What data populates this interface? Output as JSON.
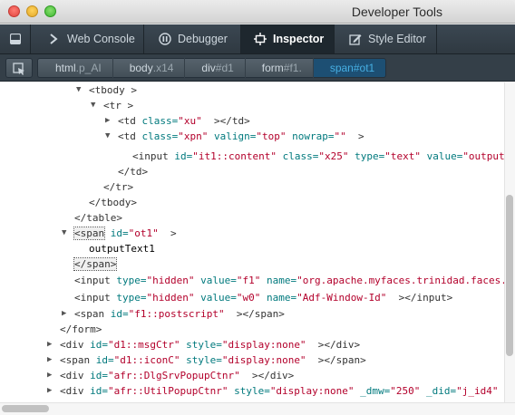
{
  "window": {
    "title": "Developer Tools"
  },
  "tabs": [
    {
      "label": "Web Console",
      "icon": "console-icon"
    },
    {
      "label": "Debugger",
      "icon": "pause-icon"
    },
    {
      "label": "Inspector",
      "icon": "inspector-icon",
      "active": true
    },
    {
      "label": "Style Editor",
      "icon": "style-editor-icon"
    }
  ],
  "breadcrumbs": [
    {
      "tag": "html",
      "attr": ".p_AI"
    },
    {
      "tag": "body",
      "attr": ".x14"
    },
    {
      "tag": "div",
      "attr": "#d1"
    },
    {
      "tag": "form",
      "attr": "#f1."
    },
    {
      "tag": "span",
      "attr": "#ot1",
      "selected": true
    }
  ],
  "markup": {
    "l1": {
      "tag": "<tbody",
      "close": " >"
    },
    "l2": {
      "tag": "<tr",
      "close": " >"
    },
    "l3": {
      "tag": "<td",
      "a1n": " class=",
      "a1v": "\"xu\"",
      "close": "  ></td>"
    },
    "l4": {
      "tag": "<td",
      "a1n": " class=",
      "a1v": "\"xpn\"",
      "a2n": " valign=",
      "a2v": "\"top\"",
      "a3n": " nowrap=",
      "a3v": "\"\"",
      "close": "  >"
    },
    "l5": {
      "tag": "<input",
      "a1n": " id=",
      "a1v": "\"it1::content\"",
      "a2n": " class=",
      "a2v": "\"x25\"",
      "a3n": " type=",
      "a3v": "\"text\"",
      "a4n": " value=",
      "a4v": "\"output"
    },
    "l6": {
      "text": "</td>"
    },
    "l7": {
      "text": "</tr>"
    },
    "l8": {
      "text": "</tbody>"
    },
    "l9": {
      "text": "</table>"
    },
    "l10": {
      "tag": "<span",
      "a1n": " id=",
      "a1v": "\"ot1\"",
      "close": "  >"
    },
    "l11": {
      "text": "outputText1"
    },
    "l12": {
      "text": "</span>"
    },
    "l13": {
      "tag": "<input",
      "a1n": " type=",
      "a1v": "\"hidden\"",
      "a2n": " value=",
      "a2v": "\"f1\"",
      "a3n": " name=",
      "a3v": "\"org.apache.myfaces.trinidad.faces."
    },
    "l14": {
      "tag": "<input",
      "a1n": " type=",
      "a1v": "\"hidden\"",
      "a2n": " value=",
      "a2v": "\"w0\"",
      "a3n": " name=",
      "a3v": "\"Adf-Window-Id\"",
      "close": "  ></input>"
    },
    "l15": {
      "tag": "<span",
      "a1n": " id=",
      "a1v": "\"f1::postscript\"",
      "close": "  ></span>"
    },
    "l16": {
      "text": "</form>"
    },
    "l17": {
      "tag": "<div",
      "a1n": " id=",
      "a1v": "\"d1::msgCtr\"",
      "a2n": " style=",
      "a2v": "\"display:none\"",
      "close": "  ></div>"
    },
    "l18": {
      "tag": "<span",
      "a1n": " id=",
      "a1v": "\"d1::iconC\"",
      "a2n": " style=",
      "a2v": "\"display:none\"",
      "close": "  ></span>"
    },
    "l19": {
      "tag": "<div",
      "a1n": " id=",
      "a1v": "\"afr::DlgSrvPopupCtnr\"",
      "close": "  ></div>"
    },
    "l20": {
      "tag": "<div",
      "a1n": " id=",
      "a1v": "\"afr::UtilPopupCtnr\"",
      "a2n": " style=",
      "a2v": "\"display:none\"",
      "a3n": " _dmw=",
      "a3v": "\"250\"",
      "a4n": " _did=",
      "a4v": "\"j_id4\""
    }
  },
  "colors": {
    "tag": "#333333",
    "attr_name": "#00797d",
    "attr_value": "#b3002b",
    "crumb_selected": "#46afe3"
  }
}
